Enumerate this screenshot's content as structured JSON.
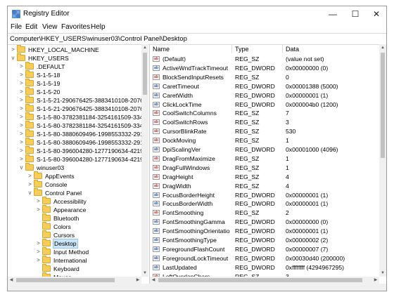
{
  "window": {
    "title": "Registry Editor",
    "minimize_glyph": "—",
    "maximize_glyph": "☐",
    "close_glyph": "✕"
  },
  "menu": [
    "File",
    "Edit",
    "View",
    "Favorites",
    "Help"
  ],
  "address": "Computer\\HKEY_USERS\\winuser03\\Control Panel\\Desktop",
  "tree": [
    {
      "label": "HKEY_LOCAL_MACHINE",
      "depth": 1,
      "expander": ">"
    },
    {
      "label": "HKEY_USERS",
      "depth": 1,
      "expander": "v"
    },
    {
      "label": ".DEFAULT",
      "depth": 2,
      "expander": ">"
    },
    {
      "label": "S-1-5-18",
      "depth": 2,
      "expander": ">"
    },
    {
      "label": "S-1-5-19",
      "depth": 2,
      "expander": ">"
    },
    {
      "label": "S-1-5-20",
      "depth": 2,
      "expander": ">"
    },
    {
      "label": "S-1-5-21-290676425-3883410108-2076",
      "depth": 2,
      "expander": ">"
    },
    {
      "label": "S-1-5-21-290676425-3883410108-2076",
      "depth": 2,
      "expander": ">"
    },
    {
      "label": "S-1-5-80-3782381184-3254161509-334",
      "depth": 2,
      "expander": ">"
    },
    {
      "label": "S-1-5-80-3782381184-3254161509-334",
      "depth": 2,
      "expander": ">"
    },
    {
      "label": "S-1-5-80-3880609496-1998553332-291",
      "depth": 2,
      "expander": ">"
    },
    {
      "label": "S-1-5-80-3880609496-1998553332-291",
      "depth": 2,
      "expander": ">"
    },
    {
      "label": "S-1-5-80-396004280-1277190634-4219",
      "depth": 2,
      "expander": ">"
    },
    {
      "label": "S-1-5-80-396004280-1277190634-4219",
      "depth": 2,
      "expander": ">"
    },
    {
      "label": "winuser03",
      "depth": 2,
      "expander": "v"
    },
    {
      "label": "AppEvents",
      "depth": 3,
      "expander": ">"
    },
    {
      "label": "Console",
      "depth": 3,
      "expander": ">"
    },
    {
      "label": "Control Panel",
      "depth": 3,
      "expander": "v"
    },
    {
      "label": "Accessibility",
      "depth": 4,
      "expander": ">"
    },
    {
      "label": "Appearance",
      "depth": 4,
      "expander": ">"
    },
    {
      "label": "Bluetooth",
      "depth": 4,
      "expander": ""
    },
    {
      "label": "Colors",
      "depth": 4,
      "expander": ""
    },
    {
      "label": "Cursors",
      "depth": 4,
      "expander": ""
    },
    {
      "label": "Desktop",
      "depth": 4,
      "expander": ">",
      "selected": true
    },
    {
      "label": "Input Method",
      "depth": 4,
      "expander": ">"
    },
    {
      "label": "International",
      "depth": 4,
      "expander": ">"
    },
    {
      "label": "Keyboard",
      "depth": 4,
      "expander": ""
    },
    {
      "label": "Mouse",
      "depth": 4,
      "expander": ""
    }
  ],
  "columns": {
    "name": "Name",
    "type": "Type",
    "data": "Data"
  },
  "values": [
    {
      "icon": "ab",
      "name": "(Default)",
      "type": "REG_SZ",
      "data": "(value not set)"
    },
    {
      "icon": "ab",
      "name": "ActiveWndTrackTimeout",
      "type": "REG_DWORD",
      "data": "0x00000000 (0)"
    },
    {
      "icon": "ab",
      "name": "BlockSendInputResets",
      "type": "REG_SZ",
      "data": "0"
    },
    {
      "icon": "ab",
      "name": "CaretTimeout",
      "type": "REG_DWORD",
      "data": "0x00001388 (5000)"
    },
    {
      "icon": "ab",
      "name": "CaretWidth",
      "type": "REG_DWORD",
      "data": "0x00000001 (1)"
    },
    {
      "icon": "ab",
      "name": "ClickLockTime",
      "type": "REG_DWORD",
      "data": "0x000004b0 (1200)"
    },
    {
      "icon": "ab",
      "name": "CoolSwitchColumns",
      "type": "REG_SZ",
      "data": "7"
    },
    {
      "icon": "ab",
      "name": "CoolSwitchRows",
      "type": "REG_SZ",
      "data": "3"
    },
    {
      "icon": "ab",
      "name": "CursorBlinkRate",
      "type": "REG_SZ",
      "data": "530"
    },
    {
      "icon": "ab",
      "name": "DockMoving",
      "type": "REG_SZ",
      "data": "1"
    },
    {
      "icon": "ab",
      "name": "DpiScalingVer",
      "type": "REG_DWORD",
      "data": "0x00001000 (4096)"
    },
    {
      "icon": "ab",
      "name": "DragFromMaximize",
      "type": "REG_SZ",
      "data": "1"
    },
    {
      "icon": "ab",
      "name": "DragFullWindows",
      "type": "REG_SZ",
      "data": "1"
    },
    {
      "icon": "ab",
      "name": "DragHeight",
      "type": "REG_SZ",
      "data": "4"
    },
    {
      "icon": "ab",
      "name": "DragWidth",
      "type": "REG_SZ",
      "data": "4"
    },
    {
      "icon": "ab",
      "name": "FocusBorderHeight",
      "type": "REG_DWORD",
      "data": "0x00000001 (1)"
    },
    {
      "icon": "ab",
      "name": "FocusBorderWidth",
      "type": "REG_DWORD",
      "data": "0x00000001 (1)"
    },
    {
      "icon": "ab",
      "name": "FontSmoothing",
      "type": "REG_SZ",
      "data": "2"
    },
    {
      "icon": "ab",
      "name": "FontSmoothingGamma",
      "type": "REG_DWORD",
      "data": "0x00000000 (0)"
    },
    {
      "icon": "ab",
      "name": "FontSmoothingOrientation",
      "type": "REG_DWORD",
      "data": "0x00000001 (1)"
    },
    {
      "icon": "ab",
      "name": "FontSmoothingType",
      "type": "REG_DWORD",
      "data": "0x00000002 (2)"
    },
    {
      "icon": "ab",
      "name": "ForegroundFlashCount",
      "type": "REG_DWORD",
      "data": "0x00000007 (7)"
    },
    {
      "icon": "ab",
      "name": "ForegroundLockTimeout",
      "type": "REG_DWORD",
      "data": "0x00030d40 (200000)"
    },
    {
      "icon": "ab",
      "name": "LastUpdated",
      "type": "REG_DWORD",
      "data": "0xffffffff (4294967295)"
    },
    {
      "icon": "ab",
      "name": "LeftOverlapChars",
      "type": "REG_SZ",
      "data": "3"
    }
  ],
  "colors": {
    "selection": "#cce4f7",
    "folder": "#f6cd5a",
    "string_icon": "#c0392b",
    "dword_icon": "#2a5db0"
  }
}
